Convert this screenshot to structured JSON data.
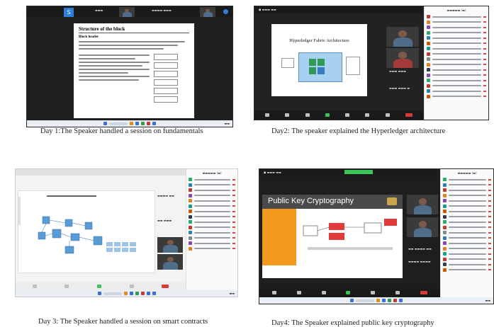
{
  "panels": [
    {
      "id": "day1",
      "caption": "Day 1:The Speaker handled a session on fundamentals",
      "slide": {
        "title": "Structure of the block",
        "subtitle": "Block header"
      },
      "tiles": [
        {
          "avatar_letter": "S",
          "avatar_color": "#2f7ed8"
        }
      ]
    },
    {
      "id": "day2",
      "caption": "Day2: The speaker explained the Hyperledger architecture",
      "slide": {
        "title": "Hyperledger Fabric Architecture"
      }
    },
    {
      "id": "day3",
      "caption": "Day 3: The Speaker handled a session on smart contracts"
    },
    {
      "id": "day4",
      "caption": "Day4: The Speaker explained public key cryptography",
      "slide": {
        "title": "Public Key Cryptography"
      }
    }
  ],
  "colors": {
    "zoom_green": "#3cc35a",
    "zoom_end_red": "#d83a3a",
    "pkc_banner": "#4a4a4a",
    "pkc_orange": "#f29a1d"
  }
}
